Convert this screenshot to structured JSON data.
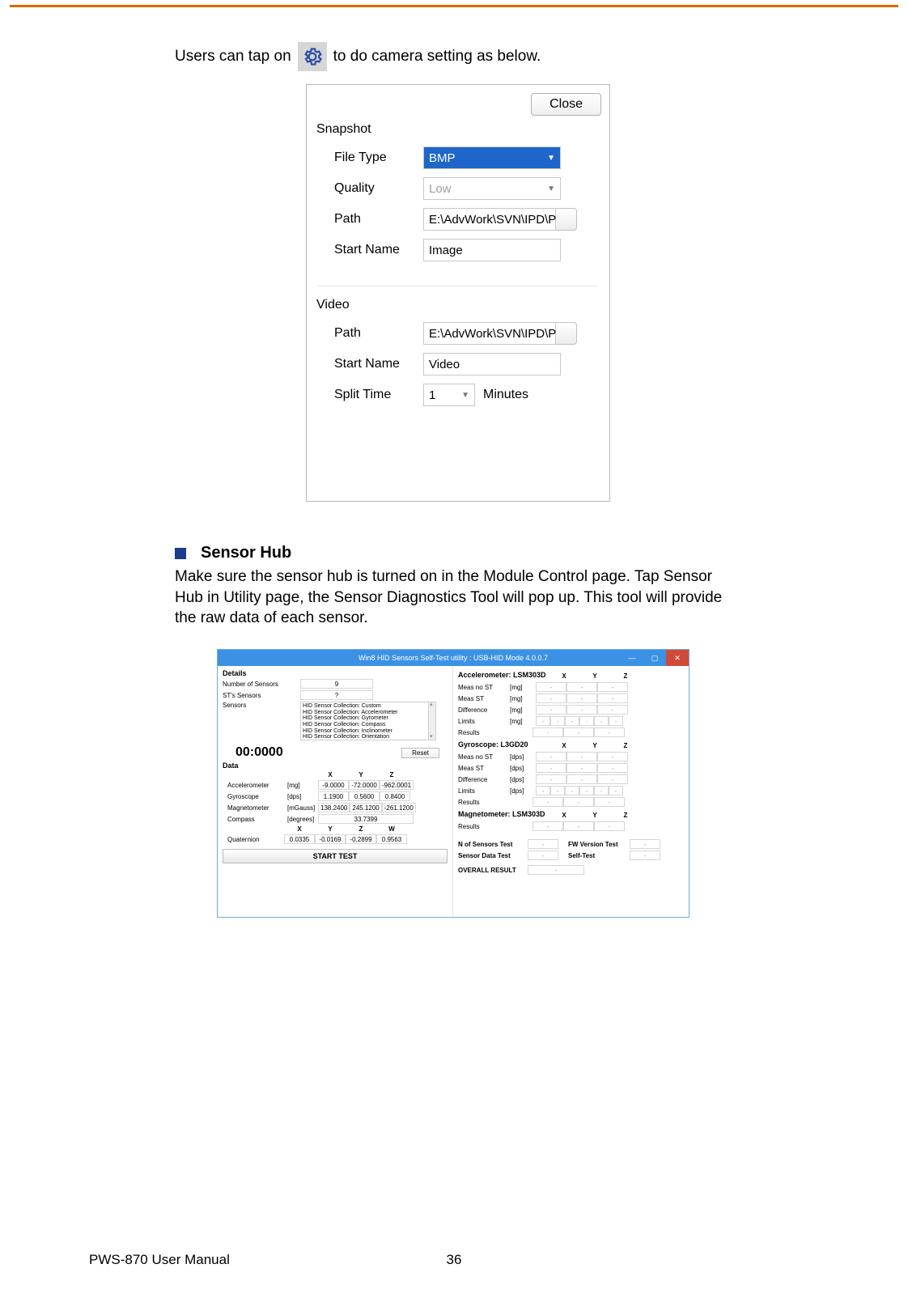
{
  "intro": {
    "before": "Users can tap on",
    "after": "to do camera setting as below.",
    "icon": "gear-icon"
  },
  "cam": {
    "close": "Close",
    "snapshot": {
      "title": "Snapshot",
      "file_type": {
        "label": "File Type",
        "value": "BMP"
      },
      "quality": {
        "label": "Quality",
        "value": "Low"
      },
      "path": {
        "label": "Path",
        "value": "E:\\AdvWork\\SVN\\IPD\\P"
      },
      "start_name": {
        "label": "Start Name",
        "value": "Image"
      }
    },
    "video": {
      "title": "Video",
      "path": {
        "label": "Path",
        "value": "E:\\AdvWork\\SVN\\IPD\\P"
      },
      "start_name": {
        "label": "Start Name",
        "value": "Video"
      },
      "split": {
        "label": "Split Time",
        "value": "1",
        "unit": "Minutes"
      }
    }
  },
  "section": {
    "title": "Sensor Hub",
    "body": "Make sure the sensor hub is turned on in the Module Control page. Tap Sensor Hub in Utility page, the Sensor Diagnostics Tool will pop up. This tool will provide the raw data of each sensor."
  },
  "sensor": {
    "title": "Win8 HID Sensors Self-Test utility : USB-HID Mode 4.0.0.7",
    "details": "Details",
    "num_sensors": {
      "label": "Number of Sensors",
      "value": "9"
    },
    "sts_sensors": {
      "label": "ST's Sensors",
      "value": "?"
    },
    "sensors_label": "Sensors",
    "sensors_list": [
      "HID Sensor Collection: Custom",
      "HID Sensor Collection: Accelerometer",
      "HID Sensor Collection: Gyrometer",
      "HID Sensor Collection: Compass",
      "HID Sensor Collection: Inclinometer",
      "HID Sensor Collection: Orientation"
    ],
    "timer": "00:0000",
    "reset": "Reset",
    "data": "Data",
    "axes3": [
      "X",
      "Y",
      "Z"
    ],
    "axes4": [
      "X",
      "Y",
      "Z",
      "W"
    ],
    "accel": {
      "label": "Accelerometer",
      "unit": "[mg]",
      "v": [
        "-9.0000",
        "-72.0000",
        "-962.0001"
      ]
    },
    "gyro": {
      "label": "Gyroscope",
      "unit": "[dps]",
      "v": [
        "1.1900",
        "0.5600",
        "0.8400"
      ]
    },
    "magn": {
      "label": "Magnetometer",
      "unit": "[mGauss]",
      "v": [
        "138.2400",
        "245.1200",
        "-261.1200"
      ]
    },
    "compass": {
      "label": "Compass",
      "unit": "[degrees]",
      "v": "33.7399"
    },
    "quat": {
      "label": "Quaternion",
      "v": [
        "0.0335",
        "-0.0169",
        "-0.2899",
        "0.9563"
      ]
    },
    "start": "START TEST",
    "right": {
      "accel_title": "Accelerometer: LSM303D",
      "gyro_title": "Gyroscope: L3GD20",
      "magn_title": "Magnetometer: LSM303D",
      "rows": [
        {
          "label": "Meas no ST",
          "unit": "[mg]"
        },
        {
          "label": "Meas ST",
          "unit": "[mg]"
        },
        {
          "label": "Difference",
          "unit": "[mg]"
        },
        {
          "label": "Limits",
          "unit": "[mg]"
        },
        {
          "label": "Results",
          "unit": ""
        }
      ],
      "rows2": [
        {
          "label": "Meas no ST",
          "unit": "[dps]"
        },
        {
          "label": "Meas ST",
          "unit": "[dps]"
        },
        {
          "label": "Difference",
          "unit": "[dps]"
        },
        {
          "label": "Limits",
          "unit": "[dps]"
        },
        {
          "label": "Results",
          "unit": ""
        }
      ],
      "n_sensors_test": "N of Sensors Test",
      "fw_version_test": "FW Version Test",
      "sensor_data_test": "Sensor Data Test",
      "self_test": "Self-Test",
      "overall": "OVERALL RESULT"
    }
  },
  "footer": {
    "left": "PWS-870 User Manual",
    "page": "36"
  }
}
